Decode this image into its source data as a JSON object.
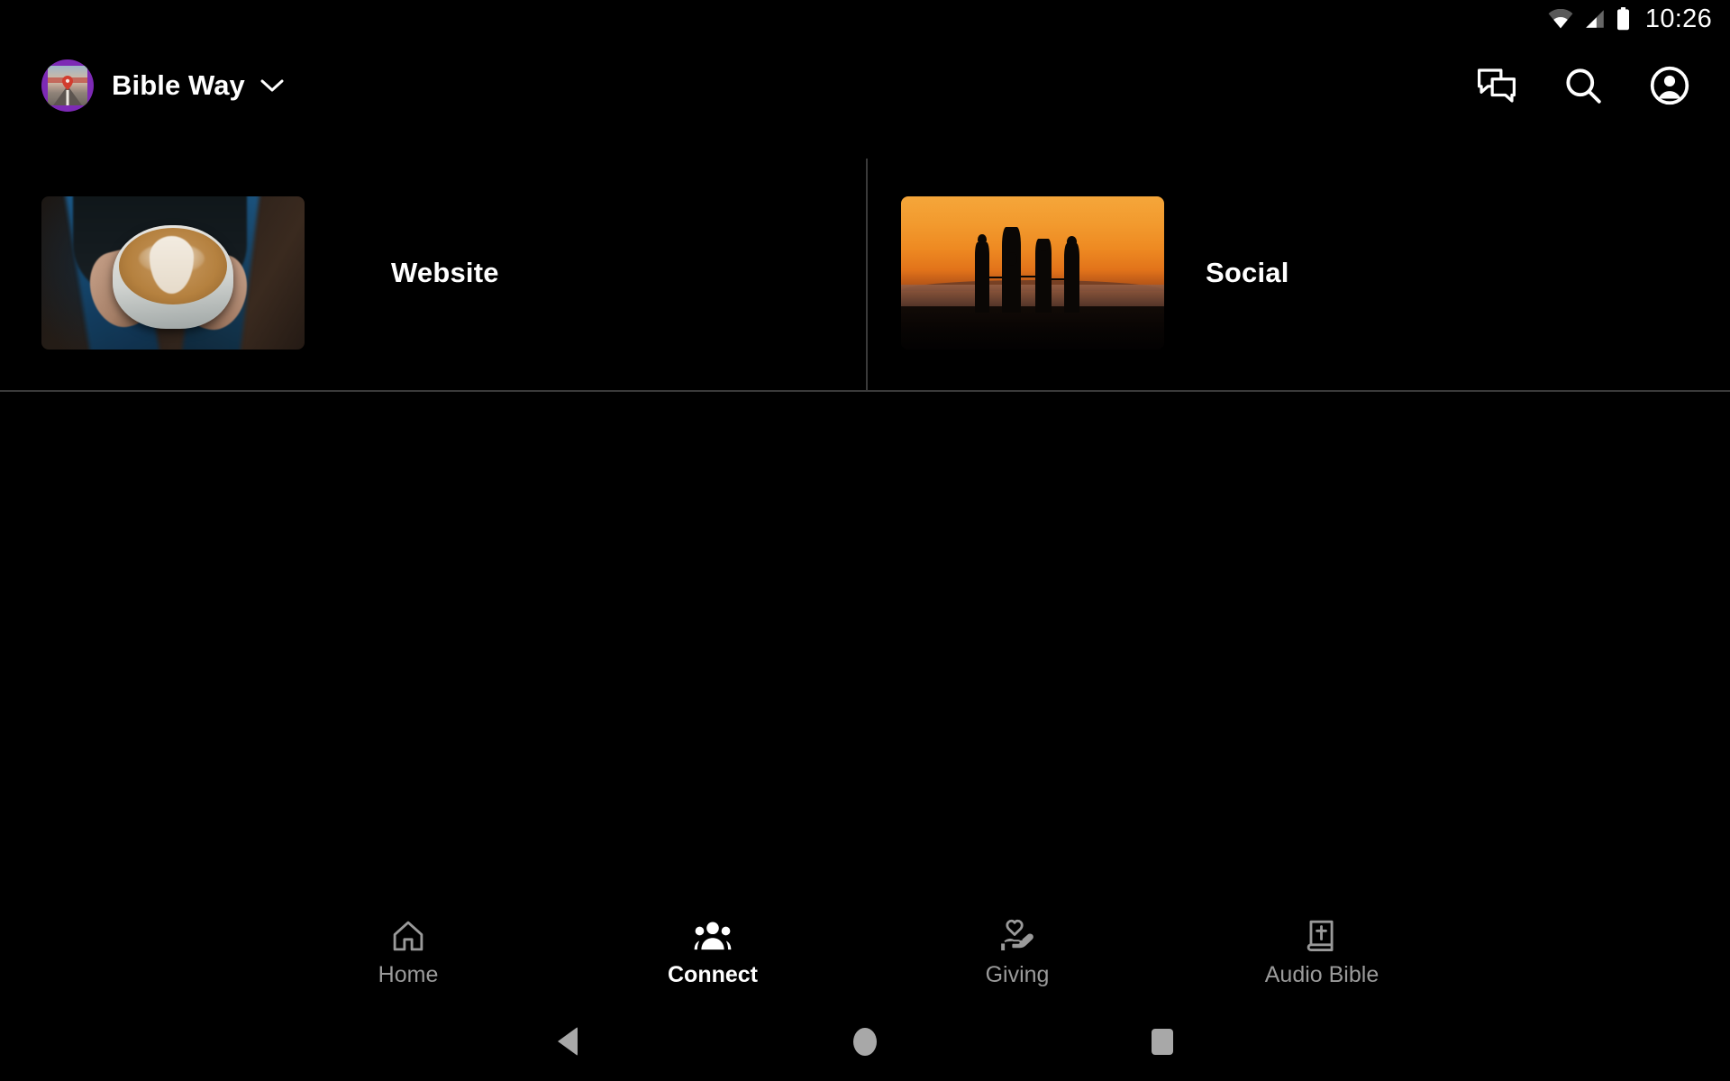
{
  "status_bar": {
    "time": "10:26",
    "icons": [
      "wifi-icon",
      "cellular-signal-icon",
      "battery-icon"
    ]
  },
  "header": {
    "org_name": "Bible Way",
    "avatar_name": "organization-avatar",
    "avatar_color": "#7d2ab5",
    "chevron_icon": "chevron-down-icon",
    "actions": [
      {
        "icon": "chat-bubbles-icon",
        "label": "Messages"
      },
      {
        "icon": "search-icon",
        "label": "Search"
      },
      {
        "icon": "account-circle-icon",
        "label": "Account"
      }
    ]
  },
  "main": {
    "tiles": [
      {
        "label": "Website",
        "image": "hands-holding-latte-photo"
      },
      {
        "label": "Social",
        "image": "family-silhouette-sunset-photo"
      }
    ],
    "divider_color": "#3a3a3a"
  },
  "bottom_nav": {
    "active_index": 1,
    "active_color": "#ffffff",
    "inactive_color": "#9a9a9a",
    "items": [
      {
        "label": "Home",
        "icon": "home-icon"
      },
      {
        "label": "Connect",
        "icon": "groups-icon"
      },
      {
        "label": "Giving",
        "icon": "hand-heart-icon"
      },
      {
        "label": "Audio Bible",
        "icon": "bible-book-icon"
      }
    ]
  },
  "system_nav": {
    "items": [
      {
        "label": "Back",
        "icon": "back-triangle-icon"
      },
      {
        "label": "Home",
        "icon": "home-circle-icon"
      },
      {
        "label": "Recents",
        "icon": "recents-square-icon"
      }
    ]
  }
}
